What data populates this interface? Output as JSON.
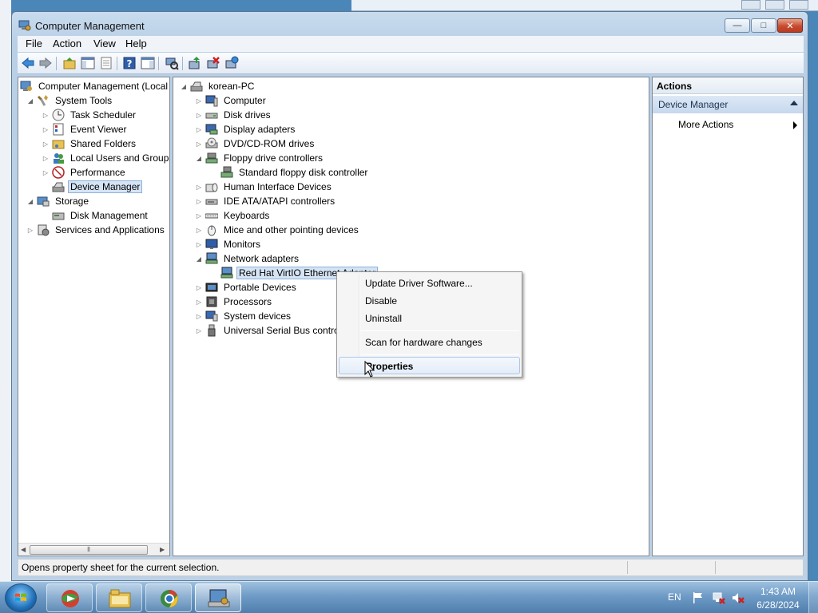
{
  "window": {
    "title": "Computer Management",
    "controls": {
      "minimize": "—",
      "maximize": "□",
      "close": "✕"
    }
  },
  "menubar": [
    "File",
    "Action",
    "View",
    "Help"
  ],
  "left_tree": {
    "root": "Computer Management (Local",
    "system_tools": "System Tools",
    "task_scheduler": "Task Scheduler",
    "event_viewer": "Event Viewer",
    "shared_folders": "Shared Folders",
    "local_users": "Local Users and Groups",
    "performance": "Performance",
    "device_manager": "Device Manager",
    "storage": "Storage",
    "disk_management": "Disk Management",
    "services": "Services and Applications"
  },
  "device_tree": {
    "root": "korean-PC",
    "computer": "Computer",
    "disk_drives": "Disk drives",
    "display_adapters": "Display adapters",
    "dvd": "DVD/CD-ROM drives",
    "floppy_controllers": "Floppy drive controllers",
    "floppy_std": "Standard floppy disk controller",
    "hid": "Human Interface Devices",
    "ide": "IDE ATA/ATAPI controllers",
    "keyboards": "Keyboards",
    "mice": "Mice and other pointing devices",
    "monitors": "Monitors",
    "network_adapters": "Network adapters",
    "redhat": "Red Hat VirtIO Ethernet Adapter",
    "portable": "Portable Devices",
    "processors": "Processors",
    "system_devices": "System devices",
    "usb": "Universal Serial Bus control"
  },
  "context_menu": {
    "update_driver": "Update Driver Software...",
    "disable": "Disable",
    "uninstall": "Uninstall",
    "scan": "Scan for hardware changes",
    "properties": "Properties"
  },
  "actions": {
    "header": "Actions",
    "section": "Device Manager",
    "more_actions": "More Actions"
  },
  "status_text": "Opens property sheet for the current selection.",
  "taskbar": {
    "language": "EN",
    "time": "1:43 AM",
    "date": "6/28/2024"
  },
  "colors": {
    "taskbar": "#4f7fae",
    "selection": "#d5e4f5",
    "close_button": "#c64b2f"
  }
}
